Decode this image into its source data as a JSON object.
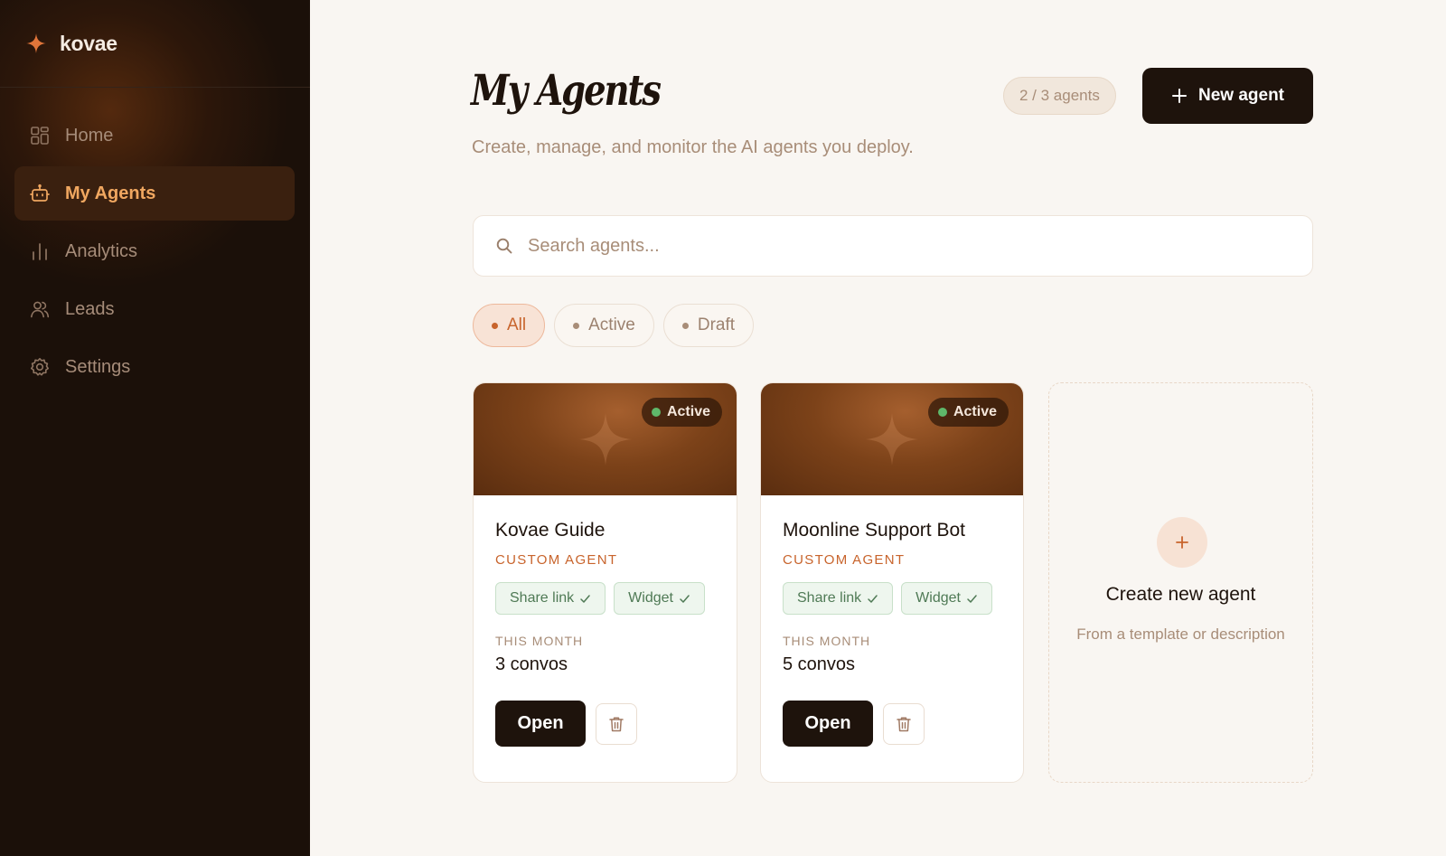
{
  "colors": {
    "sidebar_bg": "#1b1009",
    "accent": "#c8642c",
    "active_nav_text": "#f0a760",
    "primary_button": "#1e130c",
    "status_active": "#5fb86a"
  },
  "sidebar": {
    "brand": {
      "name": "kovae",
      "icon": "sparkle-logo-icon"
    },
    "items": [
      {
        "label": "Home",
        "icon": "grid-icon",
        "active": false
      },
      {
        "label": "My Agents",
        "icon": "bot-icon",
        "active": true
      },
      {
        "label": "Analytics",
        "icon": "bar-chart-icon",
        "active": false
      },
      {
        "label": "Leads",
        "icon": "users-icon",
        "active": false
      },
      {
        "label": "Settings",
        "icon": "gear-icon",
        "active": false
      }
    ]
  },
  "header": {
    "title": "My Agents",
    "subtitle": "Create, manage, and monitor the AI agents you deploy.",
    "agent_count": "2 / 3 agents",
    "new_agent_label": "New agent"
  },
  "search": {
    "placeholder": "Search agents...",
    "value": ""
  },
  "filters": [
    {
      "label": "All",
      "active": true
    },
    {
      "label": "Active",
      "active": false
    },
    {
      "label": "Draft",
      "active": false
    }
  ],
  "agents": [
    {
      "status": "Active",
      "name": "Kovae Guide",
      "type": "CUSTOM AGENT",
      "tags": [
        "Share link",
        "Widget"
      ],
      "period_label": "THIS MONTH",
      "convos": "3 convos",
      "open_label": "Open"
    },
    {
      "status": "Active",
      "name": "Moonline Support Bot",
      "type": "CUSTOM AGENT",
      "tags": [
        "Share link",
        "Widget"
      ],
      "period_label": "THIS MONTH",
      "convos": "5 convos",
      "open_label": "Open"
    }
  ],
  "create_card": {
    "title": "Create new agent",
    "subtitle": "From a template or description"
  }
}
